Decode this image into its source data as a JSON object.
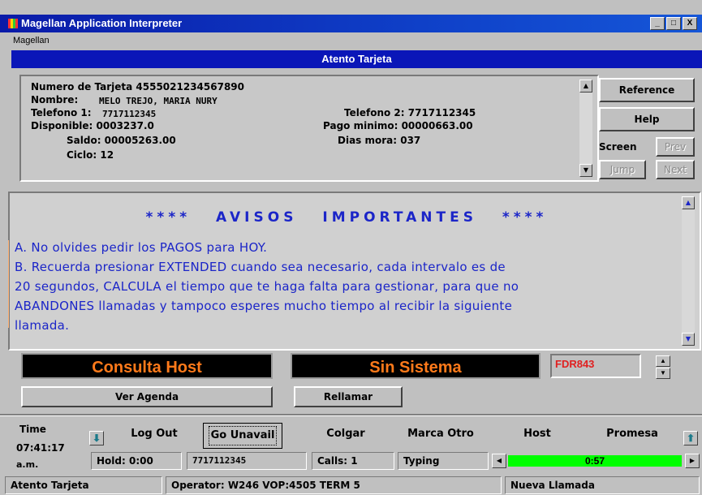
{
  "window": {
    "title": "Magellan Application Interpreter",
    "controls": [
      "_",
      "□",
      "X"
    ]
  },
  "menu": {
    "items": [
      "Magellan"
    ]
  },
  "screen": {
    "title": "Atento Tarjeta"
  },
  "account": {
    "numero_tarjeta": "Numero de Tarjeta 4555021234567890",
    "nombre_label": "Nombre:",
    "nombre_value": "MELO TREJO, MARIA NURY",
    "telefono1_label": "Telefono 1:",
    "telefono1_value": "7717112345",
    "telefono2": "Telefono 2:  7717112345",
    "disponible": "Disponible: 0003237.0",
    "pago_minimo": "Pago minimo: 00000663.00",
    "saldo": "Saldo: 00005263.00",
    "dias_mora": "Dias mora: 037",
    "ciclo": "Ciclo: 12"
  },
  "side_buttons": {
    "reference": "Reference",
    "help": "Help",
    "screen_label": "Screen",
    "prev": "Prev",
    "jump": "Jump",
    "next": "Next"
  },
  "avisos": {
    "heading": "**** AVISOS IMPORTANTES ****",
    "lines": [
      "A. No olvides pedir los PAGOS para HOY.",
      "B. Recuerda presionar EXTENDED cuando sea necesario, cada intervalo es de",
      "20 segundos, CALCULA el tiempo que te haga falta para gestionar, para que no",
      "ABANDONES llamadas y tampoco esperes mucho tiempo al recibir la siguiente",
      "llamada."
    ]
  },
  "status": {
    "consulta_host": "Consulta Host",
    "sin_sistema": "Sin Sistema",
    "fdr": "FDR843",
    "ver_agenda": "Ver Agenda",
    "rellamar": "Rellamar"
  },
  "toolbar": {
    "time_label": "Time",
    "time_value": "07:41:17",
    "ampm": "a.m.",
    "actions": [
      "Log Out",
      "Go Unavail",
      "Colgar",
      "Marca Otro",
      "Host",
      "Promesa"
    ]
  },
  "callinfo": {
    "hold": "Hold: 0:00",
    "phone": "7717112345",
    "calls": "Calls: 1",
    "state": "Typing",
    "timer": "0:57",
    "progress_fraction": 1.0,
    "progress_color": "#00ff00"
  },
  "statusbar": {
    "screen": "Atento Tarjeta",
    "operator": "Operator: W246   VOP:4505   TERM 5",
    "nueva": "Nueva Llamada"
  }
}
